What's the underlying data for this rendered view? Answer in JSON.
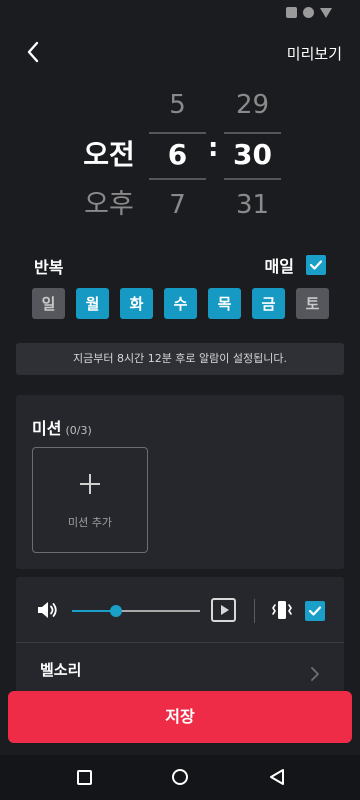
{
  "header": {
    "preview_label": "미리보기"
  },
  "picker": {
    "ampm": {
      "prev": "",
      "selected": "오전",
      "next": "오후"
    },
    "hour": {
      "prev": "5",
      "selected": "6",
      "next": "7"
    },
    "separator": ":",
    "minute": {
      "prev": "29",
      "selected": "30",
      "next": "31"
    }
  },
  "repeat": {
    "label": "반복",
    "daily_label": "매일",
    "daily_checked": true,
    "days": [
      {
        "label": "일",
        "active": false
      },
      {
        "label": "월",
        "active": true
      },
      {
        "label": "화",
        "active": true
      },
      {
        "label": "수",
        "active": true
      },
      {
        "label": "목",
        "active": true
      },
      {
        "label": "금",
        "active": true
      },
      {
        "label": "토",
        "active": false
      }
    ]
  },
  "notice": "지금부터 8시간 12분 후로 알람이 설정됩니다.",
  "mission": {
    "title": "미션",
    "count": "(0/3)",
    "add_label": "미션 추가"
  },
  "sound": {
    "volume": 0.34,
    "vibrate_checked": true,
    "ringtone_label": "벨소리"
  },
  "save_label": "저장",
  "colors": {
    "accent": "#1aa0c8",
    "save": "#ee2c48",
    "background": "#1b1c20",
    "card": "#26272c"
  }
}
